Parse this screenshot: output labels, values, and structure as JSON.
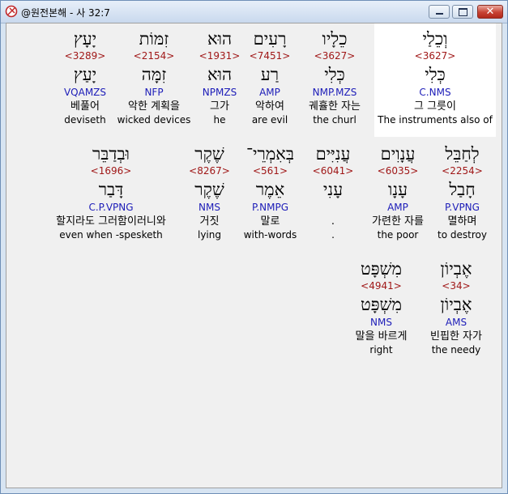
{
  "window": {
    "title": "@원전본해 - 사 32:7"
  },
  "words": [
    {
      "hebrew": "וְכֵלַי",
      "strong": "<3627>",
      "lemma": "כְּלִי",
      "morph": "C.NMS",
      "korean": "그 그릇이",
      "english": "The instruments also of"
    },
    {
      "hebrew": "כֵלָיו",
      "strong": "<3627>",
      "lemma": "כְּלִי",
      "morph": "NMP.MZS",
      "korean": "궤휼한 자는",
      "english": "the churl"
    },
    {
      "hebrew": "רָעִים",
      "strong": "<7451>",
      "lemma": "רַע",
      "morph": "AMP",
      "korean": "악하여",
      "english": "are evil"
    },
    {
      "hebrew": "הוּא",
      "strong": "<1931>",
      "lemma": "הוּא",
      "morph": "NPMZS",
      "korean": "그가",
      "english": "he"
    },
    {
      "hebrew": "זִמּוֹת",
      "strong": "<2154>",
      "lemma": "זִמָּה",
      "morph": "NFP",
      "korean": "악한 계획을",
      "english": "wicked devices"
    },
    {
      "hebrew": "יָעָץ",
      "strong": "<3289>",
      "lemma": "יָעַץ",
      "morph": "VQAMZS",
      "korean": "베풀어",
      "english": "deviseth"
    },
    {
      "hebrew": "לְחַבֵּל",
      "strong": "<2254>",
      "lemma": "חָבַל",
      "morph": "P.VPNG",
      "korean": "멸하며",
      "english": "to destroy"
    },
    {
      "hebrew": "עֲנָוִים",
      "strong": "<6035>",
      "lemma": "עָנָו",
      "morph": "AMP",
      "korean": "가련한 자를",
      "english": "the poor"
    },
    {
      "hebrew": "עֲנִיִּים",
      "strong": "<6041>",
      "lemma": "עָנִי",
      "morph": "",
      "korean": ".",
      "english": "."
    },
    {
      "hebrew": "בְּאִמְרֵי־",
      "strong": "<561>",
      "lemma": "אֵמֶר",
      "morph": "P.NMPG",
      "korean": "말로",
      "english": "with-words"
    },
    {
      "hebrew": "שֶׁקֶר",
      "strong": "<8267>",
      "lemma": "שֶׁקֶר",
      "morph": "NMS",
      "korean": "거짓",
      "english": "lying"
    },
    {
      "hebrew": "וּבְדַבֵּר",
      "strong": "<1696>",
      "lemma": "דָּבַר",
      "morph": "C.P.VPNG",
      "korean": "할지라도 그러함이러니와",
      "english": "even when -spesketh"
    },
    {
      "hebrew": "אֶבְיוֹן",
      "strong": "<34>",
      "lemma": "אֶבְיוֹן",
      "morph": "AMS",
      "korean": "빈핍한 자가",
      "english": "the needy"
    },
    {
      "hebrew": "מִשְׁפָּט",
      "strong": "<4941>",
      "lemma": "מִשְׁפָּט",
      "morph": "NMS",
      "korean": "말을 바르게",
      "english": "right"
    }
  ]
}
